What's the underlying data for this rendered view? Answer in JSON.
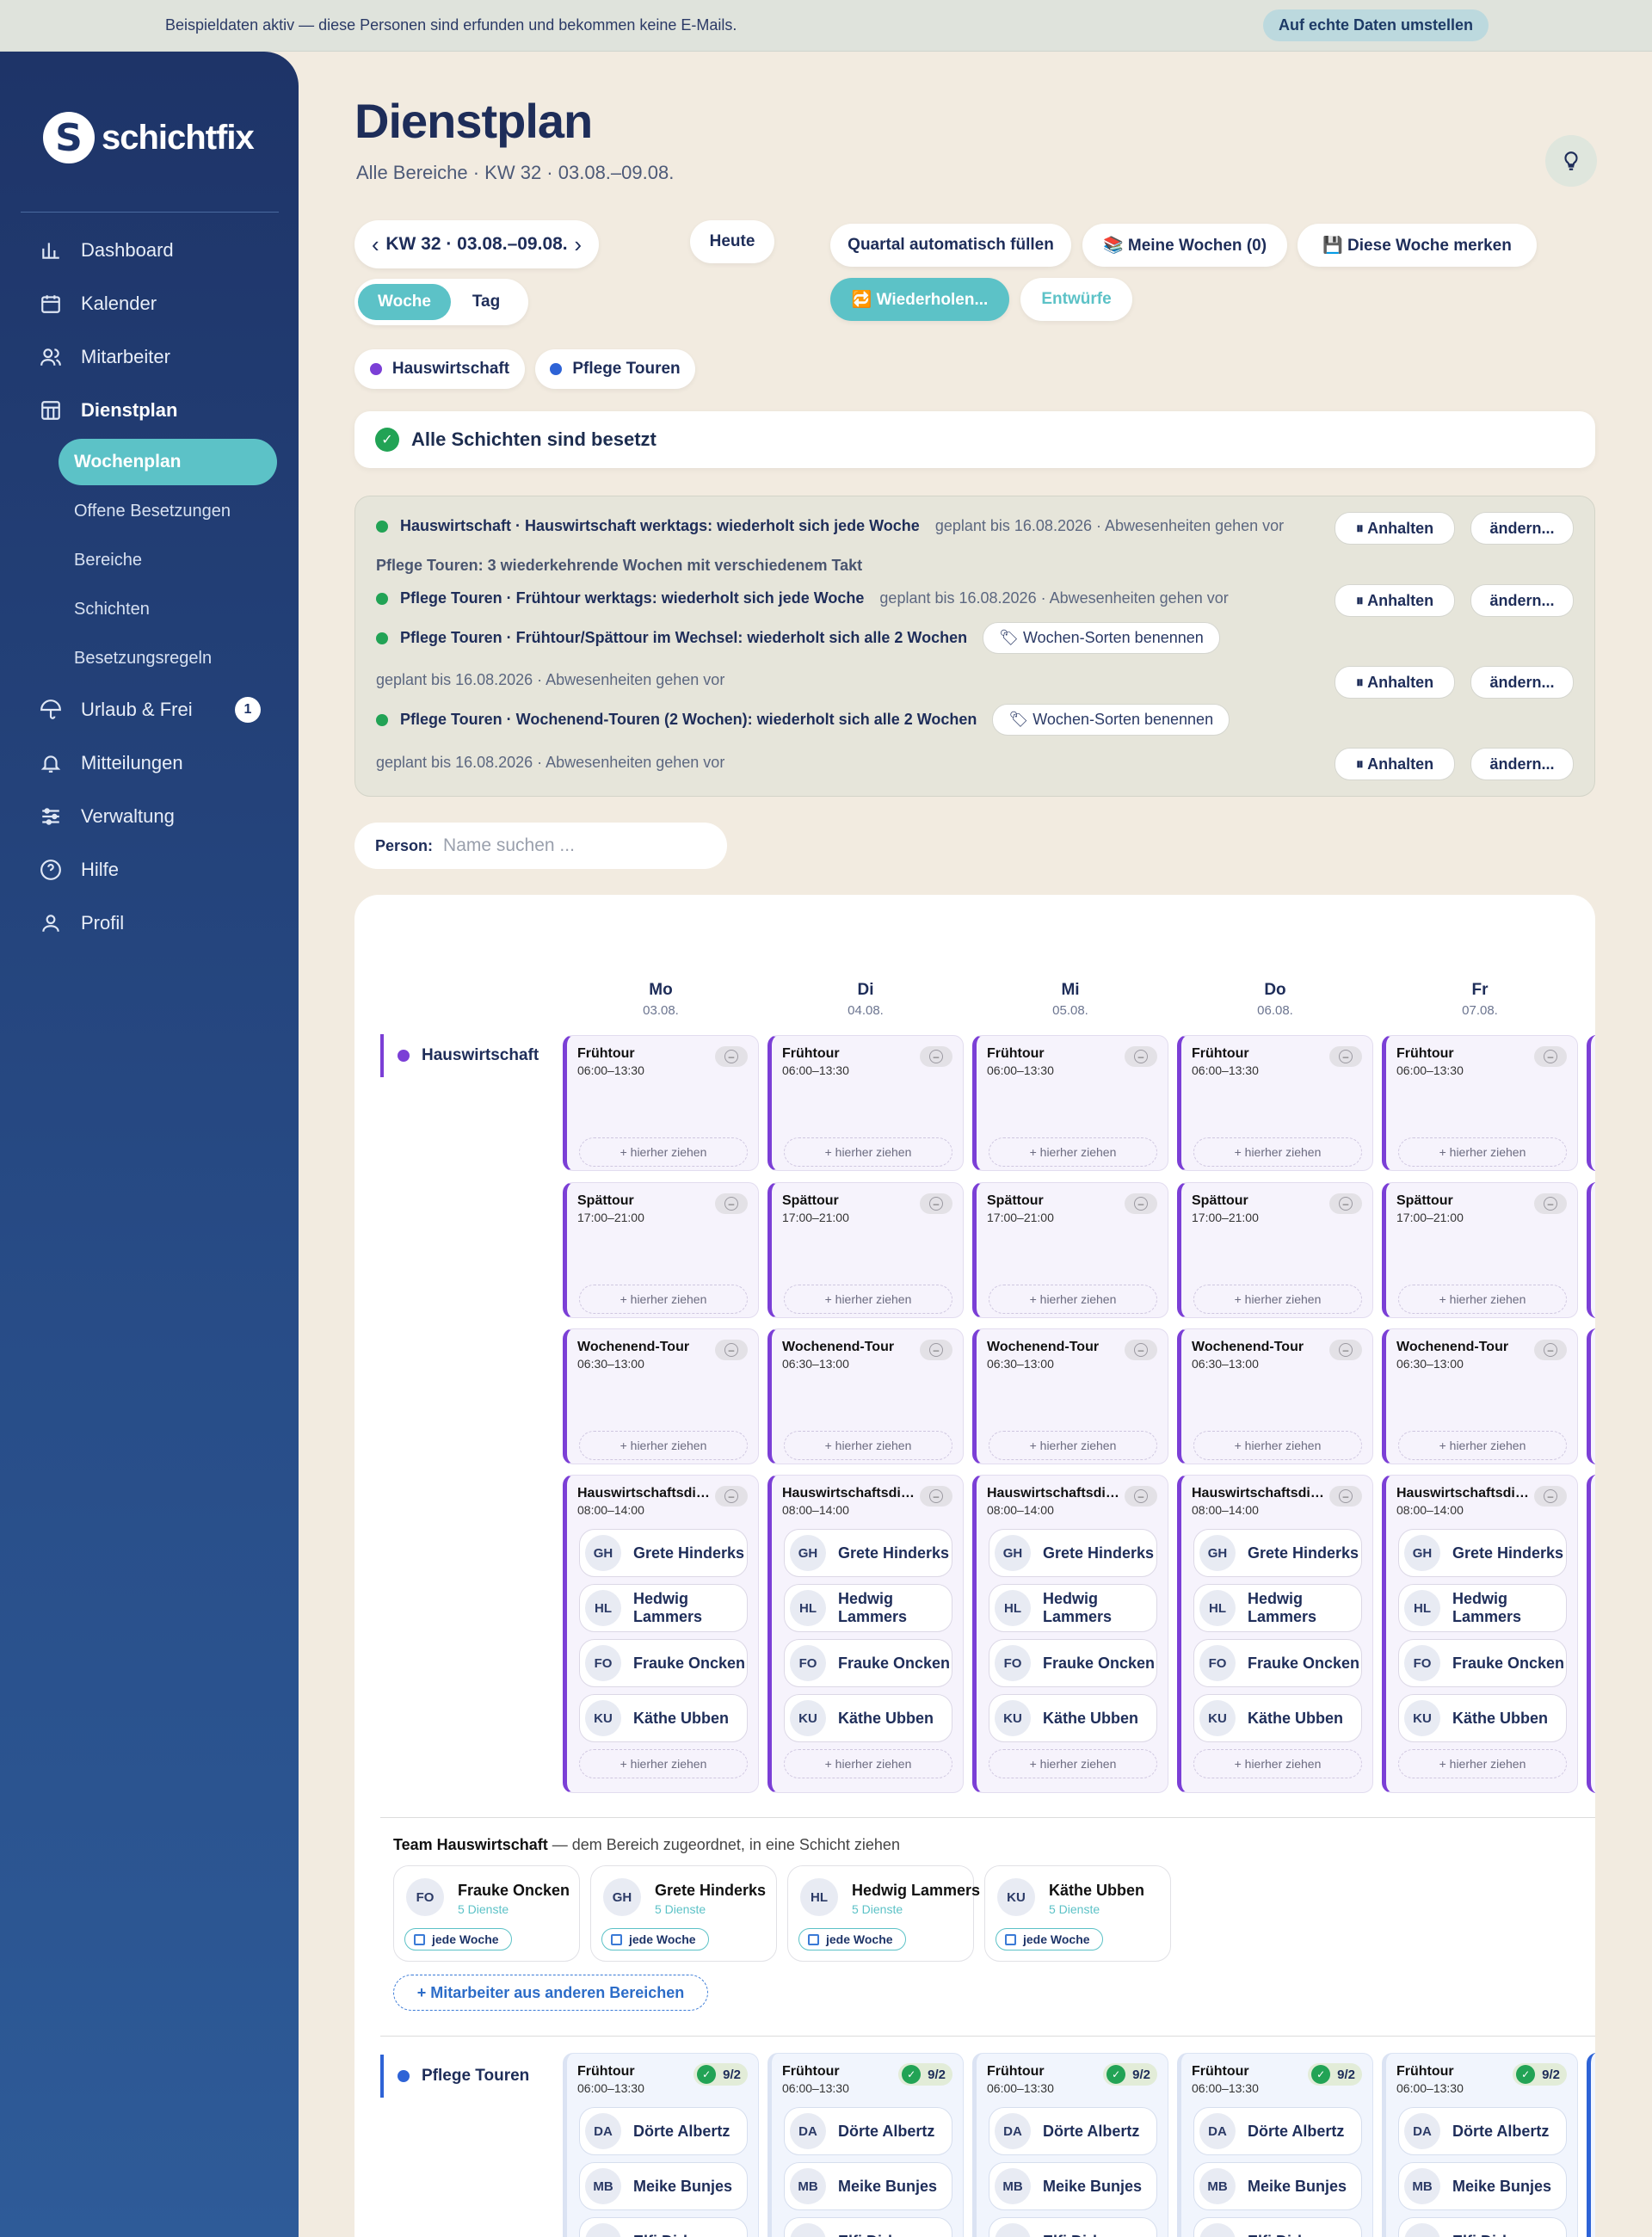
{
  "banner": {
    "text": "Beispieldaten aktiv — diese Personen sind erfunden und bekommen keine E-Mails.",
    "button": "Auf echte Daten umstellen"
  },
  "brand": {
    "name": "schichtfix",
    "mark": "S"
  },
  "nav": {
    "dashboard": "Dashboard",
    "kalender": "Kalender",
    "mitarbeiter": "Mitarbeiter",
    "dienstplan": "Dienstplan",
    "sub": [
      "Wochenplan",
      "Offene Besetzungen",
      "Bereiche",
      "Schichten",
      "Besetzungsregeln"
    ],
    "urlaub": "Urlaub & Frei",
    "urlaub_badge": "1",
    "mitteilungen": "Mitteilungen",
    "verwaltung": "Verwaltung",
    "hilfe": "Hilfe",
    "profil": "Profil"
  },
  "page": {
    "title": "Dienstplan",
    "subtitle": "Alle Bereiche · KW 32 · 03.08.–09.08."
  },
  "toolbar": {
    "week": "KW 32 · 03.08.–09.08.",
    "today": "Heute",
    "view_week": "Woche",
    "view_day": "Tag",
    "quartal": "Quartal automatisch füllen",
    "meine": "📚 Meine Wochen (0)",
    "merken": "💾 Diese Woche merken",
    "wiederholen": "🔁 Wiederholen...",
    "entwuerfe": "Entwürfe"
  },
  "filters": [
    {
      "label": "Hauswirtschaft",
      "color": "#7b3fd6"
    },
    {
      "label": "Pflege Touren",
      "color": "#2e63d6"
    }
  ],
  "status": {
    "text": "Alle Schichten sind besetzt",
    "icon": "✓"
  },
  "recurrence": {
    "r1_bold": "Hauswirtschaft · Hauswirtschaft werktags: wiederholt sich jede Woche",
    "r1_meta": "geplant bis 16.08.2026 · Abwesenheiten gehen vor",
    "pflege_head": "Pflege Touren: 3 wiederkehrende Wochen mit verschiedenem Takt",
    "r2_bold": "Pflege Touren · Frühtour werktags: wiederholt sich jede Woche",
    "r2_meta": "geplant bis 16.08.2026 · Abwesenheiten gehen vor",
    "r3_bold": "Pflege Touren · Frühtour/Spättour im Wechsel: wiederholt sich alle 2 Wochen",
    "r3_meta": "geplant bis 16.08.2026 · Abwesenheiten gehen vor",
    "r4_bold": "Pflege Touren · Wochenend-Touren (2 Wochen): wiederholt sich alle 2 Wochen",
    "r4_meta": "geplant bis 16.08.2026 · Abwesenheiten gehen vor",
    "name_btn": "🏷 Wochen-Sorten benennen",
    "pause": "⏸ Anhalten",
    "edit": "ändern..."
  },
  "person": {
    "label": "Person:",
    "placeholder": "Name suchen ..."
  },
  "days": [
    {
      "d": "Mo",
      "date": "03.08."
    },
    {
      "d": "Di",
      "date": "04.08."
    },
    {
      "d": "Mi",
      "date": "05.08."
    },
    {
      "d": "Do",
      "date": "06.08."
    },
    {
      "d": "Fr",
      "date": "07.08."
    }
  ],
  "areas": {
    "hw": "Hauswirtschaft",
    "pt": "Pflege Touren"
  },
  "hw_shifts": [
    {
      "title": "Frühtour",
      "time": "06:00–13:30"
    },
    {
      "title": "Spättour",
      "time": "17:00–21:00"
    },
    {
      "title": "Wochenend-Tour",
      "time": "06:30–13:00"
    },
    {
      "title": "Hauswirtschaftsdienst",
      "time": "08:00–14:00"
    }
  ],
  "drop": "+ hierher ziehen",
  "hw_people": [
    {
      "ini": "GH",
      "name": "Grete Hinderks"
    },
    {
      "ini": "HL",
      "name": "Hedwig Lammers"
    },
    {
      "ini": "FO",
      "name": "Frauke Oncken"
    },
    {
      "ini": "KU",
      "name": "Käthe Ubben"
    }
  ],
  "team": {
    "title": "Team Hauswirtschaft",
    "desc": " — dem Bereich zugeordnet, in eine Schicht ziehen",
    "members": [
      {
        "ini": "FO",
        "name": "Frauke Oncken",
        "sub": "5 Dienste"
      },
      {
        "ini": "GH",
        "name": "Grete Hinderks",
        "sub": "5 Dienste"
      },
      {
        "ini": "HL",
        "name": "Hedwig Lammers",
        "sub": "5 Dienste"
      },
      {
        "ini": "KU",
        "name": "Käthe Ubben",
        "sub": "5 Dienste"
      }
    ],
    "badge": "jede Woche",
    "add": "+ Mitarbeiter aus anderen Bereichen"
  },
  "pt_shift": {
    "title": "Frühtour",
    "time": "06:00–13:30",
    "count": "9/2"
  },
  "pt_people": [
    {
      "ini": "DA",
      "name": "Dörte Albertz"
    },
    {
      "ini": "MB",
      "name": "Meike Bunjes"
    },
    {
      "ini": "ED",
      "name": "Elfi Dirks"
    }
  ],
  "colors": {
    "accent": "#5cc2c7",
    "hw": "#7b3fd6",
    "pt": "#2e63d6",
    "ok": "#22a355",
    "navy": "#1e2d59"
  }
}
